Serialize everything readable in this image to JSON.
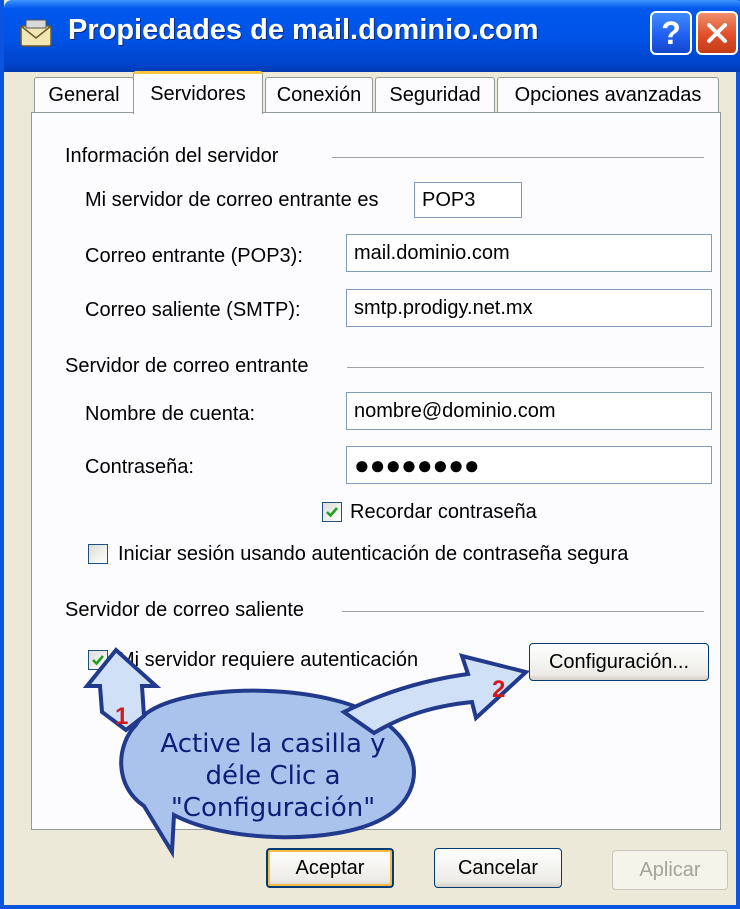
{
  "window": {
    "title": "Propiedades de mail.dominio.com",
    "help_label": "?",
    "close_label": "X"
  },
  "tabs": [
    {
      "label": "General"
    },
    {
      "label": "Servidores"
    },
    {
      "label": "Conexión"
    },
    {
      "label": "Seguridad"
    },
    {
      "label": "Opciones avanzadas"
    }
  ],
  "server_info": {
    "group_label": "Información del servidor",
    "incoming_type_label": "Mi servidor de correo entrante es",
    "incoming_type_value": "POP3",
    "incoming_label": "Correo entrante (POP3):",
    "incoming_value": "mail.dominio.com",
    "outgoing_label": "Correo saliente (SMTP):",
    "outgoing_value": "smtp.prodigy.net.mx"
  },
  "incoming_server": {
    "group_label": "Servidor de correo entrante",
    "account_label": "Nombre de cuenta:",
    "account_value": "nombre@dominio.com",
    "password_label": "Contraseña:",
    "password_value": "●●●●●●●●",
    "remember_label": "Recordar contraseña",
    "remember_checked": true,
    "spa_label": "Iniciar sesión usando autenticación de contraseña segura",
    "spa_checked": false
  },
  "outgoing_server": {
    "group_label": "Servidor de correo saliente",
    "requires_auth_label": "Mi servidor requiere autenticación",
    "requires_auth_checked": true,
    "settings_button": "Configuración..."
  },
  "annotation": {
    "step1": "1",
    "step2": "2",
    "line1": "Active la casilla y",
    "line2": "déle Clic a",
    "line3": "\"Configuración\"",
    "bubble_color": "#a9c3ec",
    "arrow_color": "#cfe0f7"
  },
  "footer": {
    "ok": "Aceptar",
    "cancel": "Cancelar",
    "apply": "Aplicar"
  }
}
